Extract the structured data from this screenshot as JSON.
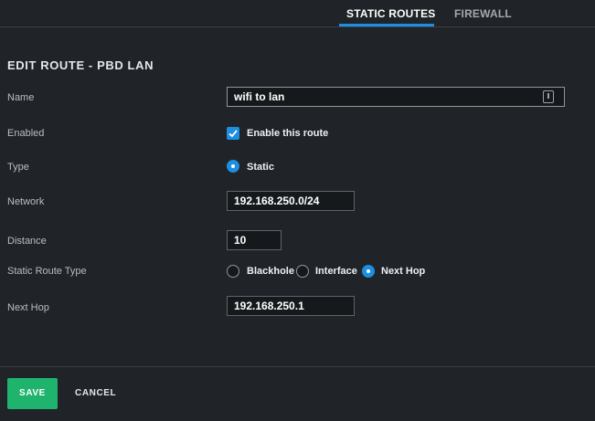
{
  "tabs": [
    {
      "label": "STATIC ROUTES",
      "active": true
    },
    {
      "label": "FIREWALL",
      "active": false
    }
  ],
  "form": {
    "title": "EDIT ROUTE - PBD LAN",
    "name": {
      "label": "Name",
      "value": "wifi to lan"
    },
    "enabled": {
      "label": "Enabled",
      "checkbox_label": "Enable this route",
      "checked": true
    },
    "type": {
      "label": "Type",
      "option": "Static",
      "selected": true
    },
    "network": {
      "label": "Network",
      "value": "192.168.250.0/24"
    },
    "distance": {
      "label": "Distance",
      "value": "10"
    },
    "static_route_type": {
      "label": "Static Route Type",
      "options": [
        {
          "label": "Blackhole",
          "selected": false
        },
        {
          "label": "Interface",
          "selected": false
        },
        {
          "label": "Next Hop",
          "selected": true
        }
      ]
    },
    "next_hop": {
      "label": "Next Hop",
      "value": "192.168.250.1"
    }
  },
  "actions": {
    "save_label": "SAVE",
    "cancel_label": "CANCEL"
  },
  "colors": {
    "accent": "#1d8fe0",
    "save": "#1fb46d",
    "background": "#202428"
  },
  "icons": {
    "name_field_icon": "contact-card-icon",
    "check": "check-icon"
  }
}
